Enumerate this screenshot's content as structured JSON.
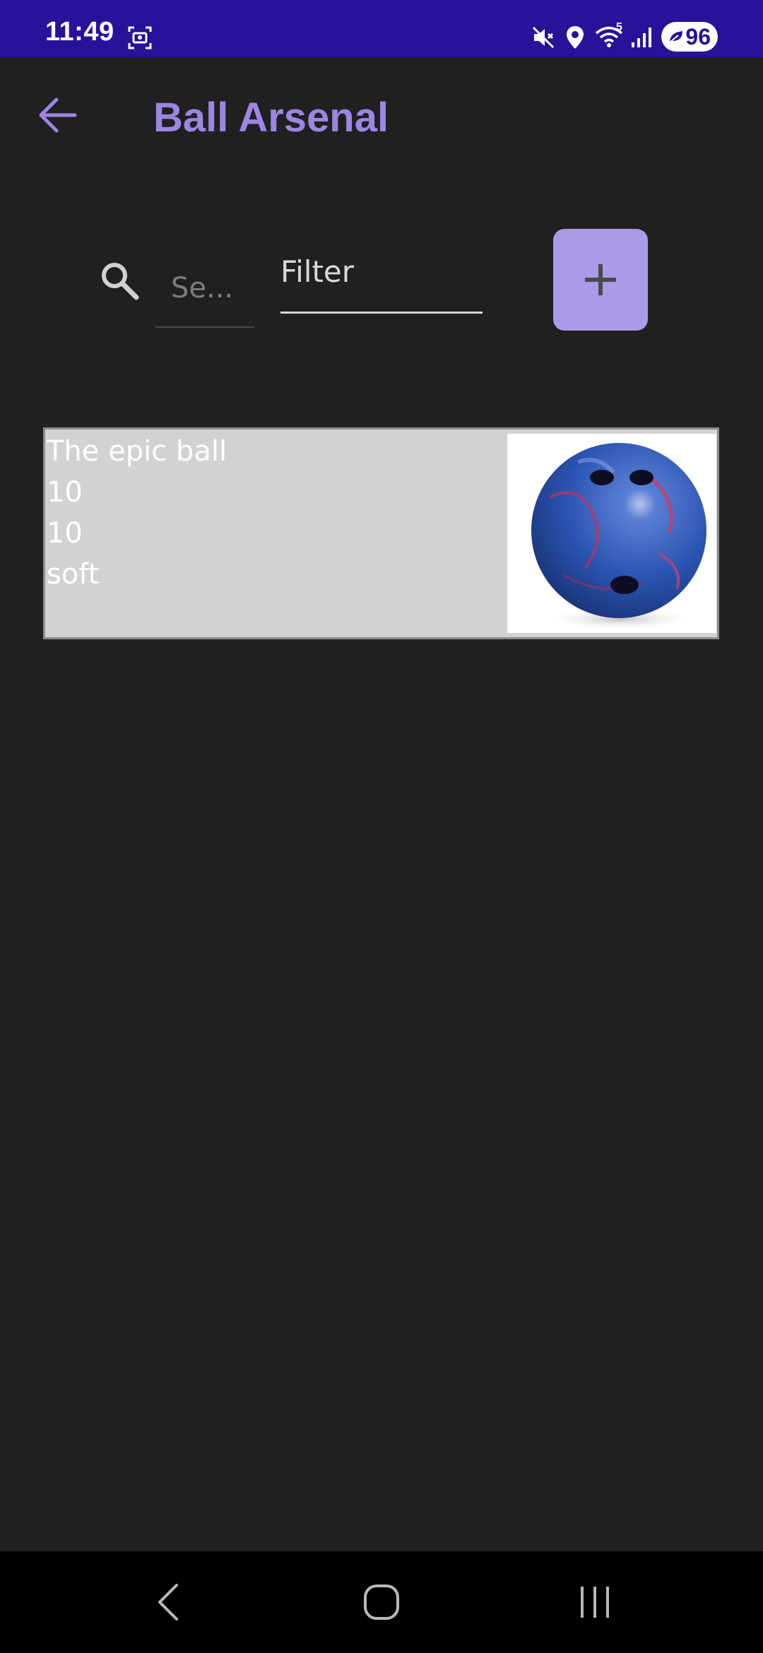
{
  "status_bar": {
    "time": "11:49",
    "battery": "96",
    "wifi_label": "5",
    "icons": [
      "screenshot-icon",
      "mute-icon",
      "location-icon",
      "wifi-icon",
      "signal-icon",
      "battery-icon"
    ]
  },
  "app_bar": {
    "title": "Ball Arsenal",
    "back_icon": "arrow-back-icon"
  },
  "search": {
    "placeholder": "Se...",
    "filter_label": "Filter",
    "add_icon": "plus-icon"
  },
  "balls": [
    {
      "name": "The epic ball",
      "field_2": "10",
      "field_3": "10",
      "field_4": "soft",
      "image": "bowling-ball-image"
    }
  ],
  "nav_bar": {
    "icons": [
      "nav-back-icon",
      "nav-home-icon",
      "nav-recents-icon"
    ]
  },
  "colors": {
    "status_bar": "#26139a",
    "background": "#202020",
    "accent": "#9d85e3",
    "add_button": "#ab9ae9",
    "card": "#d2d2d2"
  }
}
